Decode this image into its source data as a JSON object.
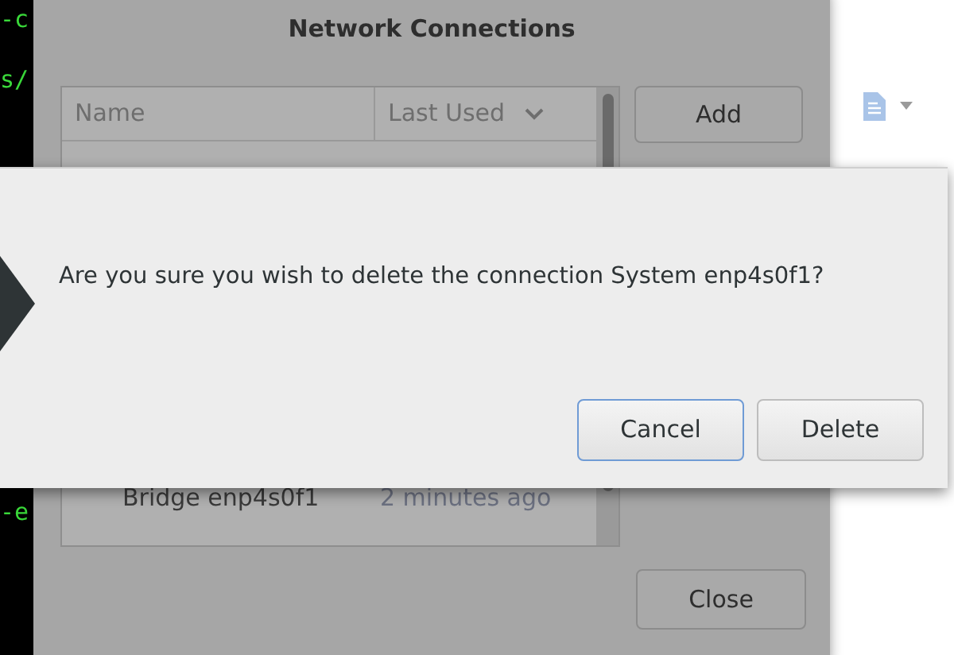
{
  "terminal": {
    "lines": [
      {
        "text": "-c"
      },
      {
        "text": "s/"
      },
      {
        "text": "-e"
      }
    ]
  },
  "network_connections": {
    "title": "Network Connections",
    "columns": [
      "Name",
      "Last Used"
    ],
    "rows": [
      {
        "name": "Bridge enp4s0f1",
        "last_used": "2 minutes ago"
      }
    ],
    "side_buttons": [
      "Add"
    ],
    "close_button": "Close"
  },
  "confirm_dialog": {
    "message": "Are you sure you wish to delete the connection System enp4s0f1?",
    "buttons": [
      {
        "label": "Cancel",
        "focused": true
      },
      {
        "label": "Delete",
        "focused": false
      }
    ]
  }
}
